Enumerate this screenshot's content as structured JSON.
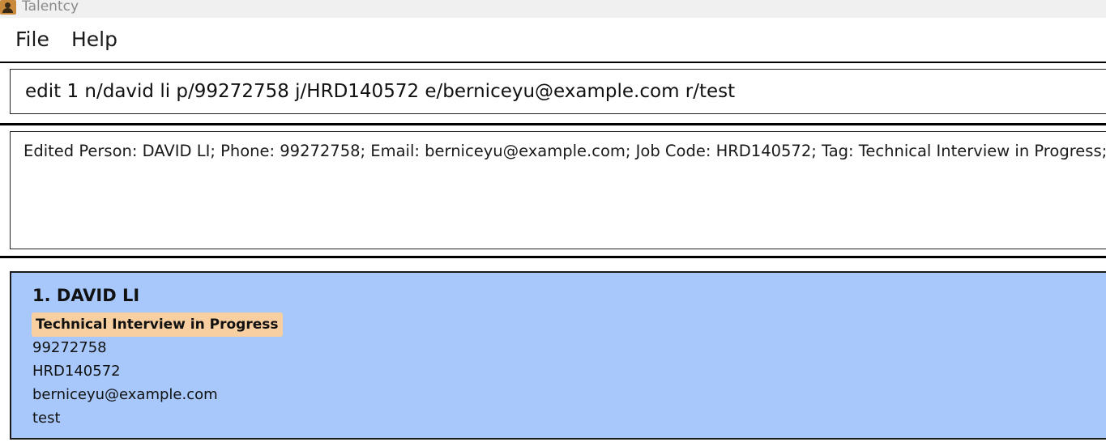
{
  "window": {
    "title": "Talentcy",
    "icon": "person-icon"
  },
  "menu": {
    "items": [
      {
        "label": "File"
      },
      {
        "label": "Help"
      }
    ]
  },
  "command": {
    "value": "edit 1 n/david li p/99272758 j/HRD140572 e/berniceyu@example.com r/test"
  },
  "result": {
    "text": "Edited Person: DAVID LI; Phone: 99272758; Email: berniceyu@example.com; Job Code: HRD140572; Tag: Technical Interview in Progress; Re"
  },
  "person_list": {
    "selected_bg": "#a8c8fb",
    "tag_bg": "#f8cfa0",
    "items": [
      {
        "name": "1. DAVID LI",
        "tag": "Technical Interview in Progress",
        "phone": "99272758",
        "job_code": "HRD140572",
        "email": "berniceyu@example.com",
        "remark": "test"
      }
    ]
  }
}
